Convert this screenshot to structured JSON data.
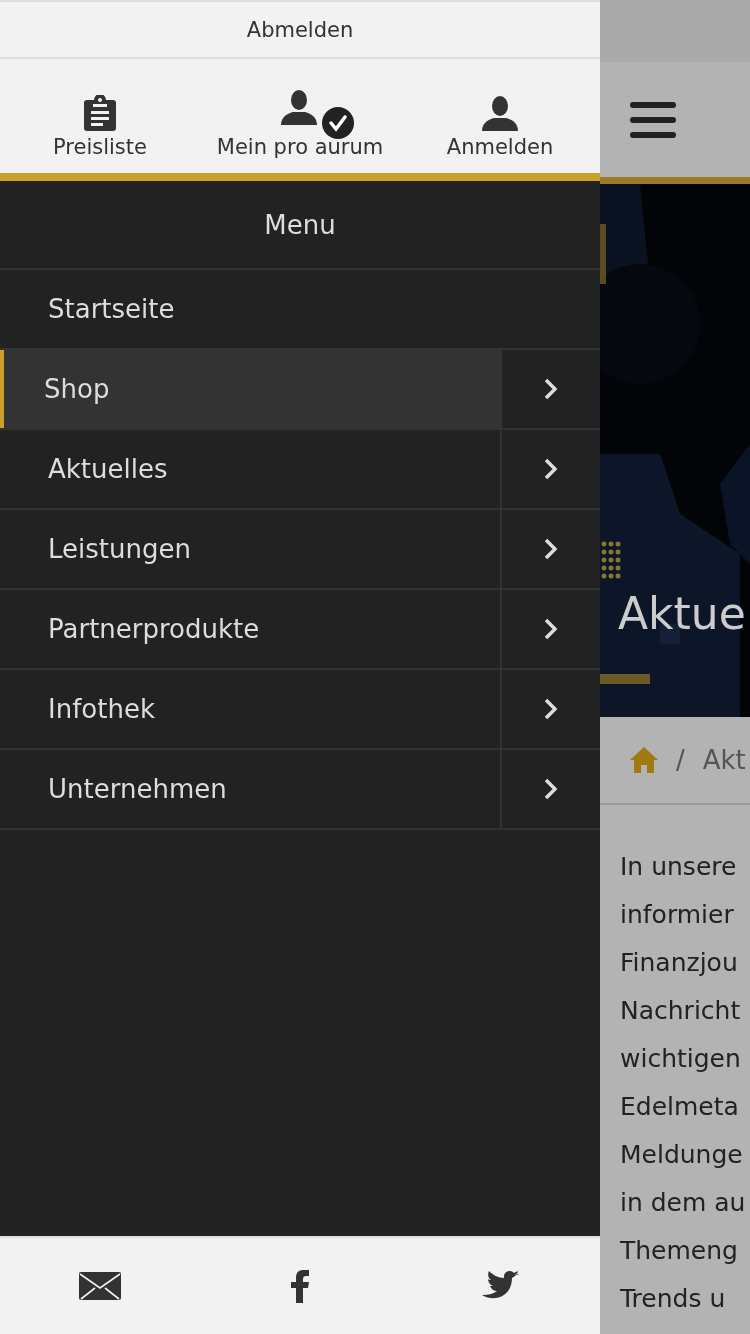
{
  "top_link": "Abmelden",
  "quick_links": [
    {
      "label": "Preisliste",
      "kind": "clipboard"
    },
    {
      "label": "Mein pro aurum",
      "kind": "user-verified"
    },
    {
      "label": "Anmelden",
      "kind": "user"
    }
  ],
  "menu": {
    "title": "Menu",
    "items": [
      {
        "label": "Startseite",
        "selected": false,
        "has_submenu": false
      },
      {
        "label": "Shop",
        "selected": true,
        "has_submenu": true
      },
      {
        "label": "Aktuelles",
        "selected": false,
        "has_submenu": true
      },
      {
        "label": "Leistungen",
        "selected": false,
        "has_submenu": true
      },
      {
        "label": "Partnerprodukte",
        "selected": false,
        "has_submenu": true
      },
      {
        "label": "Infothek",
        "selected": false,
        "has_submenu": true
      },
      {
        "label": "Unternehmen",
        "selected": false,
        "has_submenu": true
      }
    ]
  },
  "background_page": {
    "hero_title": "Aktue",
    "breadcrumb": "Akt",
    "separator": "/",
    "text_lines": [
      "In unsere",
      "informier",
      "Finanzjou",
      "Nachricht",
      "wichtigen",
      "Edelmeta",
      "Meldunge",
      "in dem au",
      "Themeng",
      "Trends u"
    ]
  }
}
